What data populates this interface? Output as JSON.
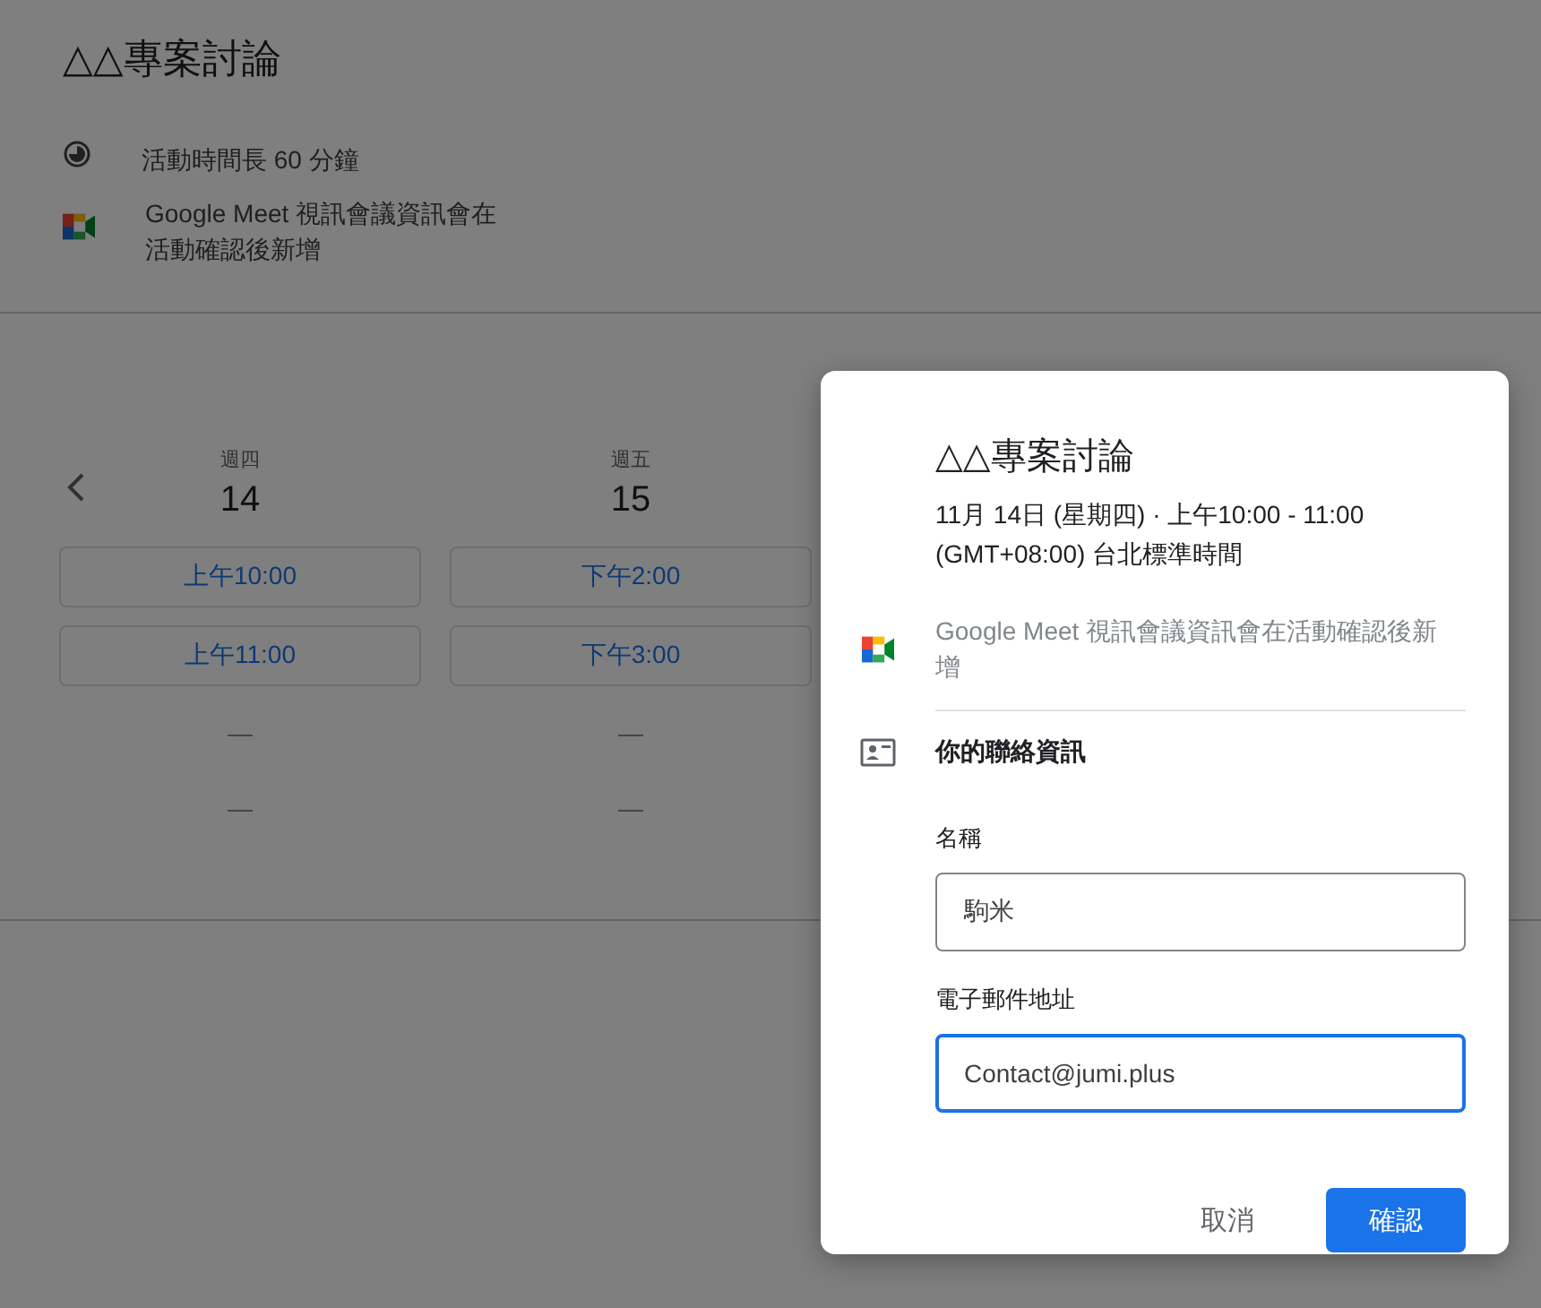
{
  "page": {
    "title": "△△專案討論",
    "info": [
      {
        "kind": "duration",
        "text": "活動時間長 60 分鐘"
      },
      {
        "kind": "meet",
        "text": "Google Meet 視訊會議資訊會在活動確認後新增"
      }
    ],
    "days": [
      {
        "weekday": "週四",
        "date": "14",
        "slots": [
          {
            "kind": "time",
            "label": "上午10:00"
          },
          {
            "kind": "time",
            "label": "上午11:00"
          },
          {
            "kind": "none",
            "label": "—"
          },
          {
            "kind": "none",
            "label": "—"
          }
        ]
      },
      {
        "weekday": "週五",
        "date": "15",
        "slots": [
          {
            "kind": "time",
            "label": "下午2:00"
          },
          {
            "kind": "time",
            "label": "下午3:00"
          },
          {
            "kind": "none",
            "label": "—"
          },
          {
            "kind": "none",
            "label": "—"
          }
        ]
      }
    ]
  },
  "dialog": {
    "title": "△△專案討論",
    "when": "11月 14日 (星期四) · 上午10:00 - 11:00",
    "timezone": "(GMT+08:00) 台北標準時間",
    "meet_note": "Google Meet 視訊會議資訊會在活動確認後新增",
    "section": "你的聯絡資訊",
    "fields": [
      {
        "label": "名稱",
        "value": "駒米",
        "focused": false
      },
      {
        "label": "電子郵件地址",
        "value": "Contact@jumi.plus",
        "focused": true
      }
    ],
    "buttons": [
      {
        "kind": "text",
        "label": "取消"
      },
      {
        "kind": "primary",
        "label": "確認"
      }
    ]
  }
}
